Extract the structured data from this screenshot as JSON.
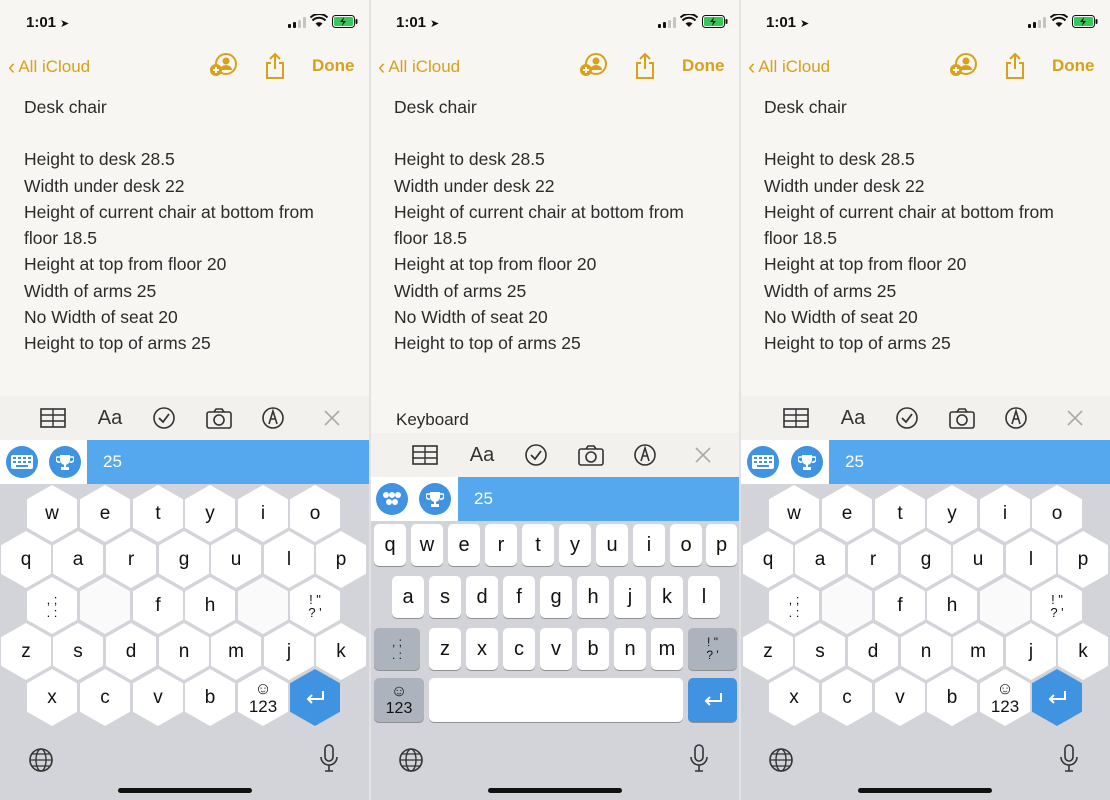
{
  "status": {
    "time": "1:01"
  },
  "nav": {
    "back_label": "All iCloud",
    "done_label": "Done"
  },
  "note": {
    "title": "Desk chair",
    "lines": [
      "Height to desk 28.5",
      "Width under desk 22",
      "Height of current chair at bottom from",
      "floor 18.5",
      "Height at top from floor 20",
      "Width of arms 25",
      "No Width of seat 20",
      "Height to top of arms 25"
    ]
  },
  "toolbar": {
    "format_label": "Aa"
  },
  "keyboard_label": "Keyboard",
  "suggestion": {
    "text": "25"
  },
  "hex_keyboard": {
    "row1": [
      "w",
      "e",
      "t",
      "y",
      "i",
      "o"
    ],
    "row2": [
      "q",
      "a",
      "r",
      "g",
      "u",
      "l",
      "p"
    ],
    "row3_mid": [
      "f",
      "h"
    ],
    "row4": [
      "z",
      "s",
      "d",
      "n",
      "m",
      "j",
      "k"
    ],
    "row5": [
      "x",
      "c",
      "v",
      "b"
    ],
    "punct_left_top": ", ;",
    "punct_left_bottom": ". :",
    "punct_right_top": "! \"",
    "punct_right_bottom": "? '",
    "emoji": "☺",
    "numbers": "123"
  },
  "qwerty_keyboard": {
    "row1": [
      "q",
      "w",
      "e",
      "r",
      "t",
      "y",
      "u",
      "i",
      "o",
      "p"
    ],
    "row2": [
      "a",
      "s",
      "d",
      "f",
      "g",
      "h",
      "j",
      "k",
      "l"
    ],
    "row3": [
      "z",
      "x",
      "c",
      "v",
      "b",
      "n",
      "m"
    ],
    "punct_left_top": ", ;",
    "punct_left_bottom": ". :",
    "punct_right_top": "! \"",
    "punct_right_bottom": "? '",
    "emoji": "☺",
    "numbers": "123"
  },
  "colors": {
    "accent": "#d8a11a",
    "keyboard_blue": "#3f93e0",
    "suggestion_blue": "#55a8ee"
  }
}
